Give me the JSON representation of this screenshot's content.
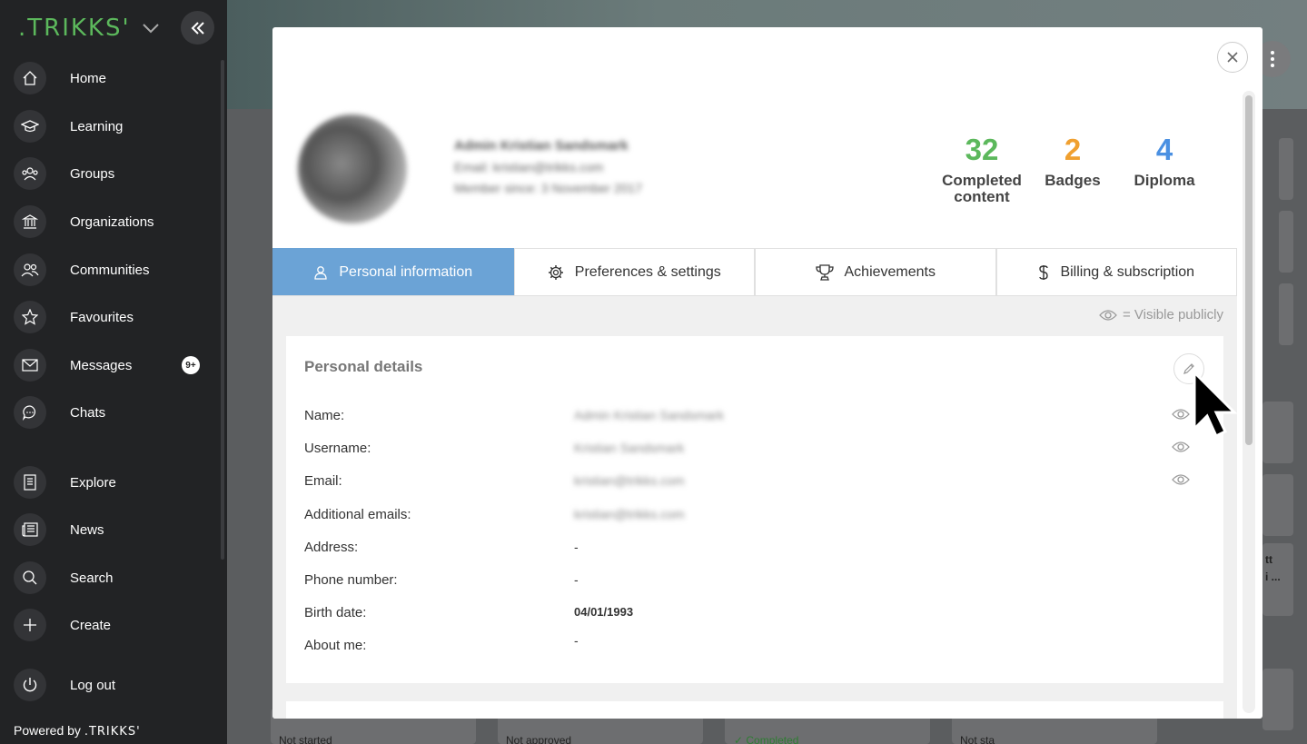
{
  "sidebar": {
    "logo": ".TRIKKS'",
    "items": [
      {
        "label": "Home",
        "icon": "home-icon"
      },
      {
        "label": "Learning",
        "icon": "graduation-cap-icon"
      },
      {
        "label": "Groups",
        "icon": "groups-icon"
      },
      {
        "label": "Organizations",
        "icon": "bank-icon"
      },
      {
        "label": "Communities",
        "icon": "communities-icon"
      },
      {
        "label": "Favourites",
        "icon": "star-icon"
      },
      {
        "label": "Messages",
        "icon": "envelope-icon",
        "badge": "9+"
      },
      {
        "label": "Chats",
        "icon": "chat-bubble-icon"
      },
      {
        "label": "Explore",
        "icon": "book-icon"
      },
      {
        "label": "News",
        "icon": "newspaper-icon"
      },
      {
        "label": "Search",
        "icon": "search-icon"
      },
      {
        "label": "Create",
        "icon": "plus-icon"
      },
      {
        "label": "Log out",
        "icon": "power-icon"
      }
    ],
    "powered_by": "Powered by",
    "powered_logo": ".TRIKKS'"
  },
  "background": {
    "statuses": [
      "Not started",
      "Not approved",
      "✓ Completed",
      "Not sta"
    ],
    "right_text": [
      "tt",
      "i ..."
    ]
  },
  "profile": {
    "name": "Admin Kristian Sandsmark",
    "email": "Email: kristian@trikks.com",
    "member_since": "Member since: 3 November 2017"
  },
  "stats": [
    {
      "value": "32",
      "label": "Completed content",
      "color": "#5cb85c"
    },
    {
      "value": "2",
      "label": "Badges",
      "color": "#f0a030"
    },
    {
      "value": "4",
      "label": "Diploma",
      "color": "#4a90e2"
    }
  ],
  "tabs": [
    {
      "label": "Personal information",
      "icon": "user-icon",
      "active": true
    },
    {
      "label": "Preferences & settings",
      "icon": "gear-icon",
      "active": false
    },
    {
      "label": "Achievements",
      "icon": "trophy-icon",
      "active": false
    },
    {
      "label": "Billing & subscription",
      "icon": "dollar-icon",
      "active": false
    }
  ],
  "visible_publicly": "= Visible publicly",
  "personal_details": {
    "title": "Personal details",
    "rows": [
      {
        "key": "Name:",
        "value": "Admin Kristian Sandsmark",
        "blur": true,
        "eye": true
      },
      {
        "key": "Username:",
        "value": "Kristian Sandsmark",
        "blur": true,
        "eye": true
      },
      {
        "key": "Email:",
        "value": "kristian@trikks.com",
        "blur": true,
        "eye": true
      },
      {
        "key": "Additional emails:",
        "value": "kristian@trikks.com",
        "blur": true,
        "eye": false
      },
      {
        "key": "Address:",
        "value": "-",
        "blur": false,
        "eye": false
      },
      {
        "key": "Phone number:",
        "value": "-",
        "blur": false,
        "eye": false
      },
      {
        "key": "Birth date:",
        "value": "04/01/1993",
        "blur": false,
        "bold": true,
        "eye": false
      },
      {
        "key": "About me:",
        "value": "-",
        "blur": false,
        "eye": false
      }
    ]
  },
  "colors": {
    "accent": "#6ba3d6",
    "sidebar": "#222325",
    "logo": "#5cb85c"
  }
}
